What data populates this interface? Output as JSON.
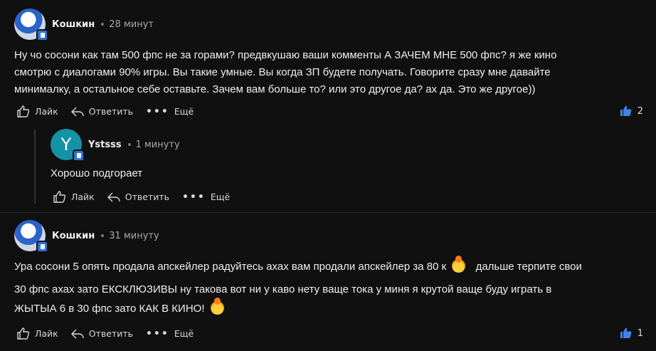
{
  "colors": {
    "background": "#101010",
    "accent": "#2f73d9",
    "text": "#efefef",
    "muted": "#a9a9a9"
  },
  "comments": [
    {
      "author": "Кошкин",
      "time": "28 минут",
      "text_lines": [
        "Ну чо сосони как там 500 фпс не за горами? предвкушаю ваши комменты А ЗАЧЕМ МНЕ 500 фпс? я же кино",
        "смотрю с диалогами 90% игры. Вы такие умные. Вы когда ЗП будете получать. Говорите сразу мне давайте",
        "минималку, а остальное себе оставьте. Зачем вам больше то? или это другое да? ах да. Это же другое))"
      ],
      "like_label": "Лайк",
      "reply_label": "Ответить",
      "more_label": "Ещё",
      "likes_count": "2"
    },
    {
      "author": "Ystsss",
      "avatar_letter": "Y",
      "time": "1 минуту",
      "text": "Хорошо подгорает",
      "like_label": "Лайк",
      "reply_label": "Ответить",
      "more_label": "Ещё"
    },
    {
      "author": "Кошкин",
      "time": "31 минуту",
      "text_line1a": "Ура сосони 5 опять продала апскейлер радуйтесь ахах вам продали апскейлер за 80 к",
      "text_line1b": "дальше терпите свои",
      "text_line2": "30 фпс ахах зато ЕКСКЛЮЗИВЫ ну такова вот ни у каво нету ваще тока у миня я крутой ваще буду играть в",
      "text_line3": "ЖЫТЫА 6 в 30 фпс зато КАК В КИНО!",
      "emoji": "fire-emoji",
      "like_label": "Лайк",
      "reply_label": "Ответить",
      "more_label": "Ещё",
      "likes_count": "1"
    }
  ]
}
